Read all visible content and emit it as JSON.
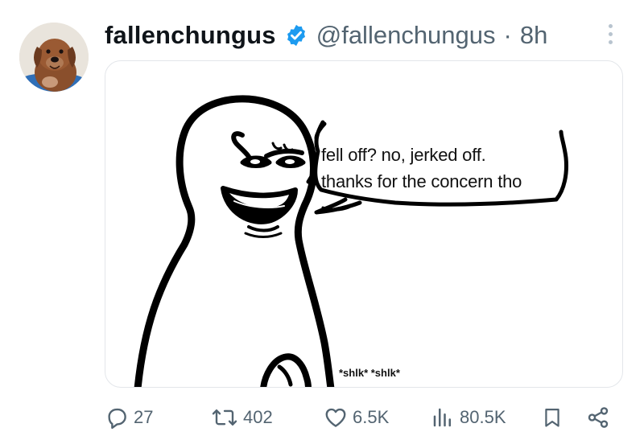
{
  "post": {
    "display_name": "fallenchungus",
    "handle": "@fallenchungus",
    "separator": "·",
    "time": "8h"
  },
  "icons": {
    "verified": "verified-badge-icon",
    "more": "more-vertical-icon",
    "reply": "reply-icon",
    "repost": "repost-icon",
    "like": "heart-icon",
    "views": "views-bar-chart-icon",
    "bookmark": "bookmark-icon",
    "share": "share-icon"
  },
  "colors": {
    "verified_blue": "#1d9bf0",
    "secondary_text": "#536471"
  },
  "media": {
    "caption_line1": "fell off? no, jerked off.",
    "caption_line2": "thanks for the concern tho",
    "sound_effect": "*shlk* *shlk*"
  },
  "stats": {
    "replies": "27",
    "reposts": "402",
    "likes": "6.5K",
    "views": "80.5K"
  }
}
